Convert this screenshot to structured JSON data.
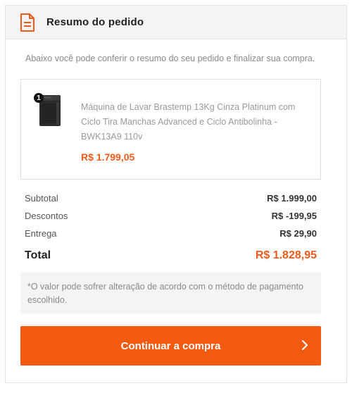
{
  "header": {
    "title": "Resumo do pedido",
    "icon": "document-icon",
    "accent": "#f05a1a"
  },
  "intro": "Abaixo você pode conferir o resumo do seu pedido e finalizar sua compra.",
  "product": {
    "quantity": "1",
    "name": "Máquina de Lavar Brastemp 13Kg Cinza Platinum com Ciclo Tira Manchas Advanced e Ciclo Antibolinha - BWK13A9 110v",
    "price": "R$ 1.799,05",
    "image": "washing-machine-thumbnail"
  },
  "summary": {
    "subtotal_label": "Subtotal",
    "subtotal_value": "R$ 1.999,00",
    "discount_label": "Descontos",
    "discount_value": "R$ -199,95",
    "shipping_label": "Entrega",
    "shipping_value": "R$ 29,90",
    "total_label": "Total",
    "total_value": "R$ 1.828,95"
  },
  "note": "*O valor pode sofrer alteração de acordo com o método de pagamento escolhido.",
  "cta": {
    "label": "Continuar a compra",
    "icon": "chevron-right-icon",
    "color": "#f25a12"
  }
}
